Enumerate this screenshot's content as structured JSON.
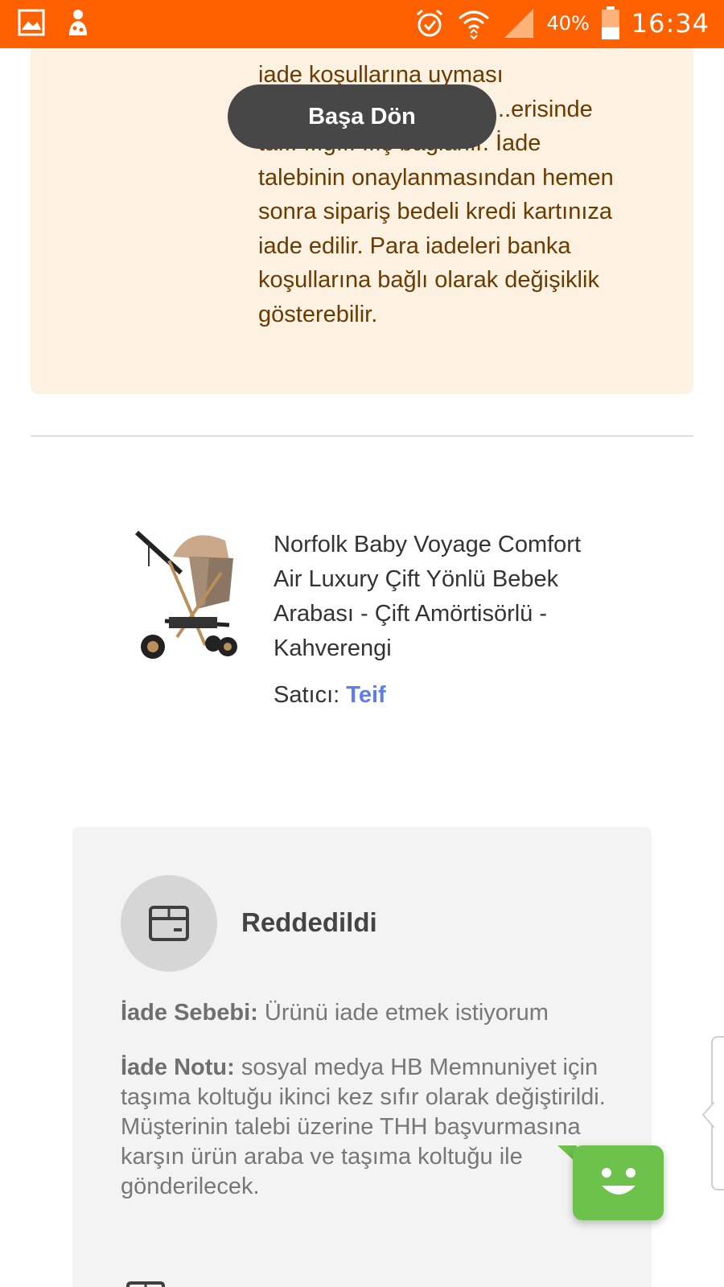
{
  "status_bar": {
    "battery": "40%",
    "time": "16:34"
  },
  "info_box": {
    "line1": "iade koşullarına uyması",
    "line2": "...erisinde",
    "line3": "ta... ...ğ... ...ş bağlanır. İade",
    "line4": "talebinin onaylanmasından hemen",
    "line5": "sonra sipariş bedeli kredi kartınıza",
    "line6": "iade edilir. Para iadeleri banka",
    "line7": "koşullarına bağlı olarak değişiklik",
    "line8": "gösterebilir."
  },
  "toast": {
    "label": "Başa Dön"
  },
  "product": {
    "title": "Norfolk Baby Voyage Comfort Air Luxury Çift Yönlü Bebek Arabası - Çift Amörtisörlü - Kahverengi",
    "seller_label": "Satıcı:",
    "seller_name": "Teif"
  },
  "return_status": {
    "status": "Reddedildi",
    "reason_label": "İade Sebebi:",
    "reason_value": "Ürünü iade etmek istiyorum",
    "note_label": "İade Notu:",
    "note_value": "sosyal medya HB Memnuniyet için taşıma koltuğu ikinci kez sıfır olarak değiştirildi. Müşterinin talebi üzerine THH başvurmasına karşın ürün araba ve taşıma koltuğu ile gönderilecek."
  },
  "colors": {
    "status_bar": "#ff6000",
    "info_box_bg": "#fdf1e1",
    "info_text": "#6a3a00",
    "seller_link": "#5f7de6",
    "chatbot": "#6cc24a"
  }
}
